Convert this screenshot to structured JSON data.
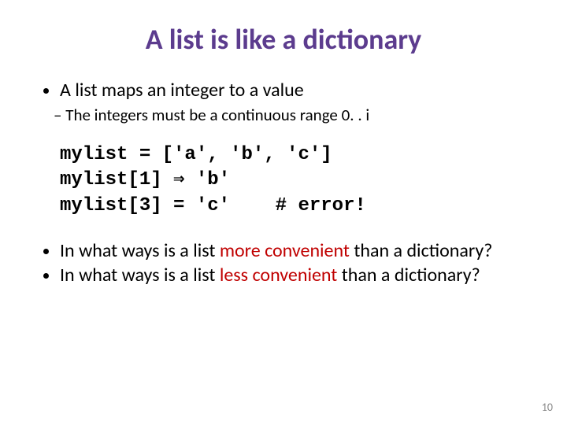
{
  "title": "A list is like a dictionary",
  "bullets": {
    "main1": "A list maps an integer to a value",
    "sub1": "The integers must be a continuous range 0. . i"
  },
  "code": {
    "l1": "mylist = ['a', 'b', 'c']",
    "l2a": "mylist[1] ",
    "l2arrow": "⇒",
    "l2b": " 'b'",
    "l3a": "mylist[3] = 'c'    ",
    "l3comment": "# error!"
  },
  "questions": {
    "q1a": "In what ways is a list ",
    "q1em": "more convenient",
    "q1b": " than a dictionary?",
    "q2a": "In what ways is a list ",
    "q2em": "less convenient",
    "q2b": " than a dictionary?"
  },
  "page": "10"
}
